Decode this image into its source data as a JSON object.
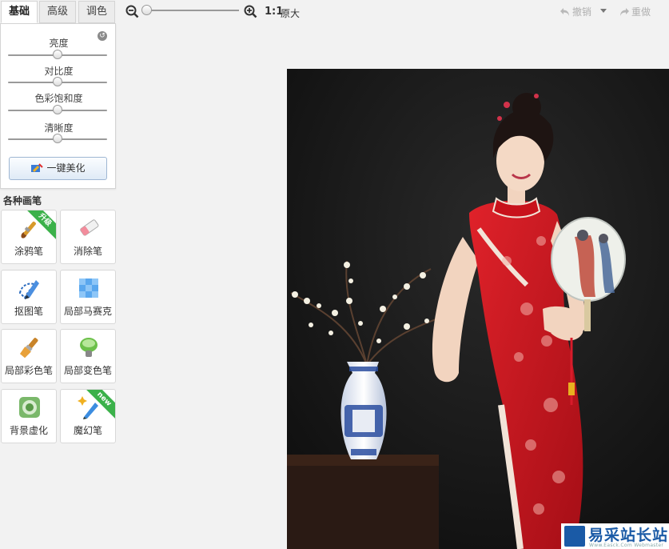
{
  "tabs": [
    {
      "label": "基础",
      "active": true
    },
    {
      "label": "高级",
      "active": false
    },
    {
      "label": "调色",
      "active": false
    }
  ],
  "adjust": {
    "sliders": [
      {
        "label": "亮度",
        "value": 0.5
      },
      {
        "label": "对比度",
        "value": 0.5
      },
      {
        "label": "色彩饱和度",
        "value": 0.5
      },
      {
        "label": "清晰度",
        "value": 0.5
      }
    ],
    "auto_beautify_label": "一键美化"
  },
  "brushes": {
    "title": "各种画笔",
    "tools": [
      {
        "label": "涂鸦笔",
        "icon": "graffiti-brush-icon",
        "badge": "升级"
      },
      {
        "label": "消除笔",
        "icon": "eraser-icon",
        "badge": ""
      },
      {
        "label": "抠图笔",
        "icon": "cutout-pen-icon",
        "badge": ""
      },
      {
        "label": "局部马赛克",
        "icon": "mosaic-icon",
        "badge": ""
      },
      {
        "label": "局部彩色笔",
        "icon": "color-brush-icon",
        "badge": ""
      },
      {
        "label": "局部变色笔",
        "icon": "recolor-brush-icon",
        "badge": ""
      },
      {
        "label": "背景虚化",
        "icon": "background-blur-icon",
        "badge": ""
      },
      {
        "label": "魔幻笔",
        "icon": "magic-pen-icon",
        "badge": "new"
      }
    ]
  },
  "toolbar": {
    "zoom_level": 0,
    "one_to_one": "1:1",
    "original_size": "原大",
    "undo_label": "撤销",
    "redo_label": "重做"
  },
  "watermark": {
    "text": "易采站长站",
    "sub": "Www.Easck.Com  Webmaster"
  },
  "colors": {
    "accent_blue": "#1a5aa6",
    "badge_green": "#3bb14a",
    "dress_red": "#c8121b"
  }
}
